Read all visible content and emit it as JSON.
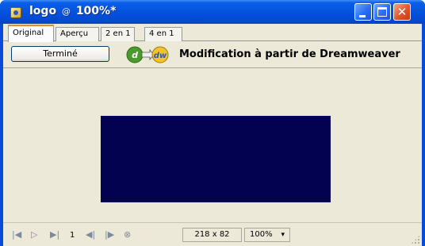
{
  "window": {
    "title_name": "logo",
    "title_at": "@",
    "title_zoom": "100%*",
    "app_icon": "fireworks-document-icon",
    "minimize_icon": "minimize-icon",
    "maximize_icon": "maximize-icon",
    "close_icon": "close-icon",
    "close_glyph": "✕"
  },
  "tabs": [
    {
      "label": "Original",
      "active": true
    },
    {
      "label": "Aperçu",
      "active": false
    },
    {
      "label": "2 en 1",
      "active": false
    },
    {
      "label": "4 en 1",
      "active": false
    }
  ],
  "toolbar": {
    "done_label": "Terminé",
    "logo_icon": "dreamweaver-edit-icon",
    "edit_label": "Modification à partir de Dreamweaver"
  },
  "canvas": {
    "image_color": "#020250"
  },
  "statusbar": {
    "first_icon": "first-frame-icon",
    "play_icon": "play-icon",
    "last_icon": "last-frame-icon",
    "frame_number": "1",
    "prev_icon": "previous-frame-icon",
    "next_icon": "next-frame-icon",
    "stop_icon": "stop-icon",
    "dimensions": "218 x 82",
    "zoom": "100%",
    "zoom_arrow": "▾",
    "resize_icon": "resize-grip-icon"
  },
  "colors": {
    "titlebar": "#0553dd",
    "active_tab_accent": "#e68b2c",
    "client_bg": "#ece9d8"
  }
}
